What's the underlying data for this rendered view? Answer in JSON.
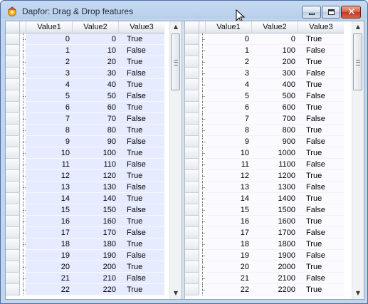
{
  "window": {
    "title": "Dapfor: Drag & Drop features",
    "buttons": {
      "minimize": "minimize-icon",
      "maximize": "maximize-icon",
      "close": "close-icon"
    }
  },
  "left_grid": {
    "columns": [
      "Value1",
      "Value2",
      "Value3"
    ],
    "rows": [
      [
        "0",
        "0",
        "True"
      ],
      [
        "1",
        "10",
        "False"
      ],
      [
        "2",
        "20",
        "True"
      ],
      [
        "3",
        "30",
        "False"
      ],
      [
        "4",
        "40",
        "True"
      ],
      [
        "5",
        "50",
        "False"
      ],
      [
        "6",
        "60",
        "True"
      ],
      [
        "7",
        "70",
        "False"
      ],
      [
        "8",
        "80",
        "True"
      ],
      [
        "9",
        "90",
        "False"
      ],
      [
        "10",
        "100",
        "True"
      ],
      [
        "11",
        "110",
        "False"
      ],
      [
        "12",
        "120",
        "True"
      ],
      [
        "13",
        "130",
        "False"
      ],
      [
        "14",
        "140",
        "True"
      ],
      [
        "15",
        "150",
        "False"
      ],
      [
        "16",
        "160",
        "True"
      ],
      [
        "17",
        "170",
        "False"
      ],
      [
        "18",
        "180",
        "True"
      ],
      [
        "19",
        "190",
        "False"
      ],
      [
        "20",
        "200",
        "True"
      ],
      [
        "21",
        "210",
        "False"
      ],
      [
        "22",
        "220",
        "True"
      ]
    ]
  },
  "right_grid": {
    "columns": [
      "Value1",
      "Value2",
      "Value3"
    ],
    "rows": [
      [
        "0",
        "0",
        "True"
      ],
      [
        "1",
        "100",
        "False"
      ],
      [
        "2",
        "200",
        "True"
      ],
      [
        "3",
        "300",
        "False"
      ],
      [
        "4",
        "400",
        "True"
      ],
      [
        "5",
        "500",
        "False"
      ],
      [
        "6",
        "600",
        "True"
      ],
      [
        "7",
        "700",
        "False"
      ],
      [
        "8",
        "800",
        "True"
      ],
      [
        "9",
        "900",
        "False"
      ],
      [
        "10",
        "1000",
        "True"
      ],
      [
        "11",
        "1100",
        "False"
      ],
      [
        "12",
        "1200",
        "True"
      ],
      [
        "13",
        "1300",
        "False"
      ],
      [
        "14",
        "1400",
        "True"
      ],
      [
        "15",
        "1500",
        "False"
      ],
      [
        "16",
        "1600",
        "True"
      ],
      [
        "17",
        "1700",
        "False"
      ],
      [
        "18",
        "1800",
        "True"
      ],
      [
        "19",
        "1900",
        "False"
      ],
      [
        "20",
        "2000",
        "True"
      ],
      [
        "21",
        "2100",
        "False"
      ],
      [
        "22",
        "2200",
        "True"
      ]
    ]
  }
}
